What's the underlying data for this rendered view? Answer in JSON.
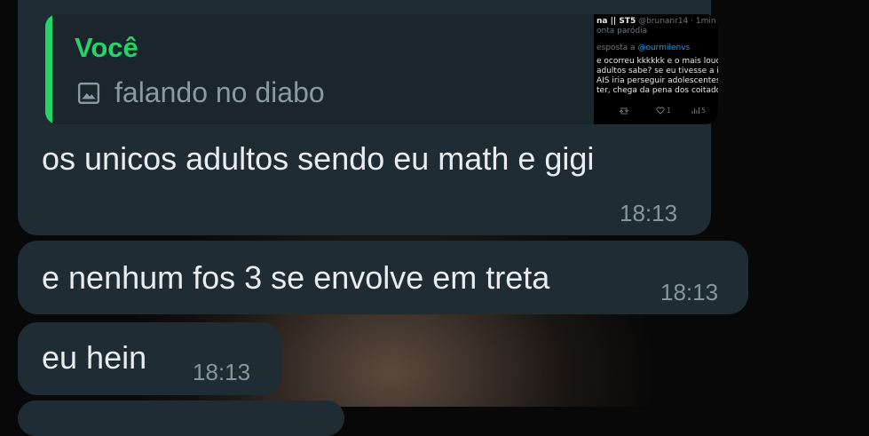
{
  "messages": [
    {
      "reply": {
        "author": "Você",
        "icon": "image-icon",
        "text": "falando no diabo",
        "thumbnail": {
          "name_line": "na || ST5",
          "handle": "@brunanr14 · 1min",
          "tag": "onta paródia",
          "reply_to_label": "esposta a",
          "reply_to_handle": "@ourmilenvs",
          "body": [
            "e ocorreu kkkkkk e o mais louc",
            "adultos sabe? se eu tivesse a id",
            "AIS iria perseguir adolescentes",
            "ter, chega da pena dos coitado"
          ],
          "likes": "1",
          "views": "5"
        }
      },
      "text": "os unicos adultos sendo eu math e gigi",
      "time": "18:13"
    },
    {
      "text": "e nenhum fos 3 se envolve em treta",
      "time": "18:13"
    },
    {
      "text": "eu hein",
      "time": "18:13"
    }
  ],
  "colors": {
    "bubble": "#1f2c34",
    "quote_bg": "#1a252c",
    "accent": "#25d366",
    "text": "#e9edef",
    "meta": "#8696a0"
  }
}
